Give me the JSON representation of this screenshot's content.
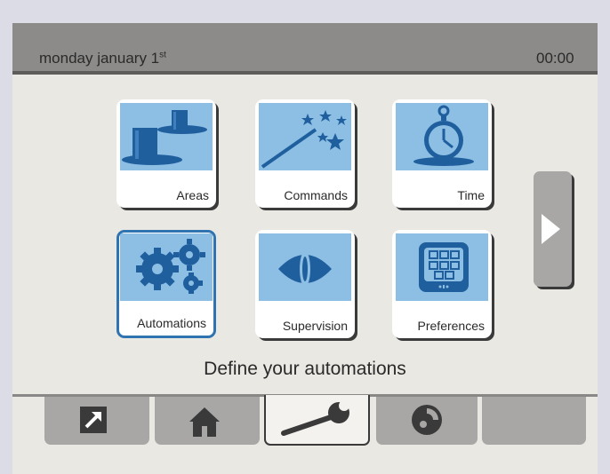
{
  "header": {
    "date_text": "monday january 1",
    "date_suffix": "st",
    "time": "00:00"
  },
  "tiles": [
    {
      "label": "Areas",
      "icon": "areas-icon"
    },
    {
      "label": "Commands",
      "icon": "magic-wand-icon"
    },
    {
      "label": "Time",
      "icon": "stopwatch-icon"
    },
    {
      "label": "Automations",
      "icon": "gears-icon",
      "active": true
    },
    {
      "label": "Supervision",
      "icon": "eye-icon"
    },
    {
      "label": "Preferences",
      "icon": "keypad-icon"
    }
  ],
  "caption": "Define your automations",
  "tabs": [
    {
      "icon": "shortcut-arrow-icon"
    },
    {
      "icon": "home-icon"
    },
    {
      "icon": "wrench-icon",
      "selected": true
    },
    {
      "icon": "disc-icon"
    },
    {
      "icon": ""
    }
  ],
  "colors": {
    "accent": "#2f73b0",
    "icon_blue": "#1f5f9e",
    "tile_bg": "#8dbee4"
  }
}
